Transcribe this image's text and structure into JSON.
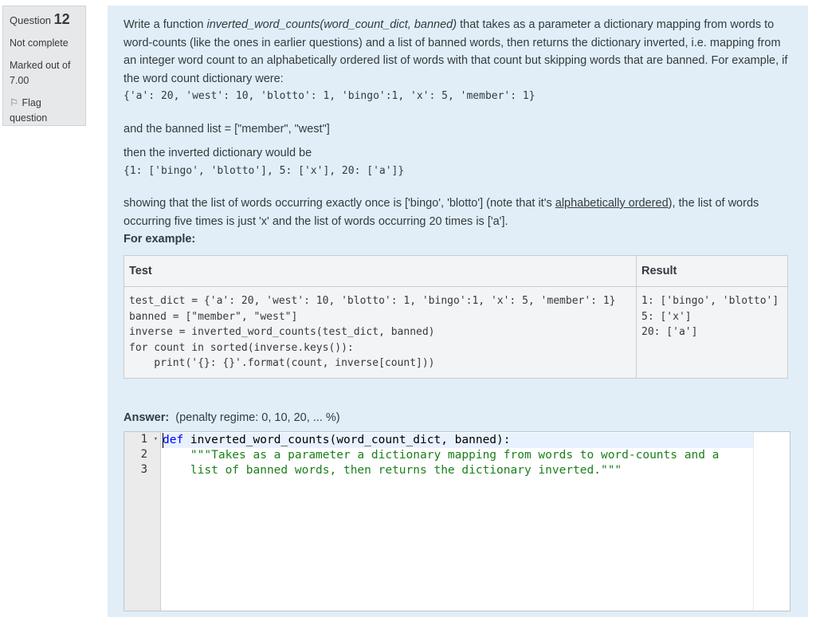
{
  "info": {
    "question_label": "Question",
    "question_number": "12",
    "state": "Not complete",
    "grade": "Marked out of 7.00",
    "flag_label": "Flag question"
  },
  "question": {
    "intro_pre": "Write a function ",
    "intro_signature": "inverted_word_counts(word_count_dict, banned)",
    "intro_post": " that takes as a parameter a dictionary mapping from words to word-counts (like the ones in earlier questions) and a list of banned words, then returns the dictionary inverted, i.e. mapping from an integer word count to an alphabetically ordered list of words with that count but skipping words that are banned. For example, if the word count dictionary were:",
    "dict_example": "{'a': 20, 'west': 10, 'blotto': 1, 'bingo':1, 'x': 5, 'member': 1}",
    "banned_text": "and the banned list = [\"member\", \"west\"]",
    "then_text": "then the inverted dictionary would be",
    "inverted_example": "{1: ['bingo', 'blotto'], 5: ['x'], 20: ['a']}",
    "showing_pre": "showing that the list of words occurring exactly once is ['bingo', 'blotto'] (note that it's ",
    "showing_link": "alphabetically ordered",
    "showing_post": "), the list of words occurring five times is just 'x' and the list of words occurring 20 times is ['a'].",
    "for_example": "For example:"
  },
  "example_table": {
    "headers": [
      "Test",
      "Result"
    ],
    "test_code": "test_dict = {'a': 20, 'west': 10, 'blotto': 1, 'bingo':1, 'x': 5, 'member': 1}\nbanned = [\"member\", \"west\"]\ninverse = inverted_word_counts(test_dict, banned)\nfor count in sorted(inverse.keys()):\n    print('{}: {}'.format(count, inverse[count]))",
    "result": "1: ['bingo', 'blotto']\n5: ['x']\n20: ['a']"
  },
  "answer": {
    "label": "Answer:",
    "penalty": "(penalty regime: 0, 10, 20, ... %)",
    "line_numbers": [
      "1",
      "2",
      "3"
    ],
    "code": {
      "l1_kw": "def",
      "l1_rest": " inverted_word_counts(word_count_dict, banned):",
      "l2": "    \"\"\"Takes as a parameter a dictionary mapping from words to word-counts and a",
      "l3": "    list of banned words, then returns the dictionary inverted.\"\"\""
    }
  }
}
